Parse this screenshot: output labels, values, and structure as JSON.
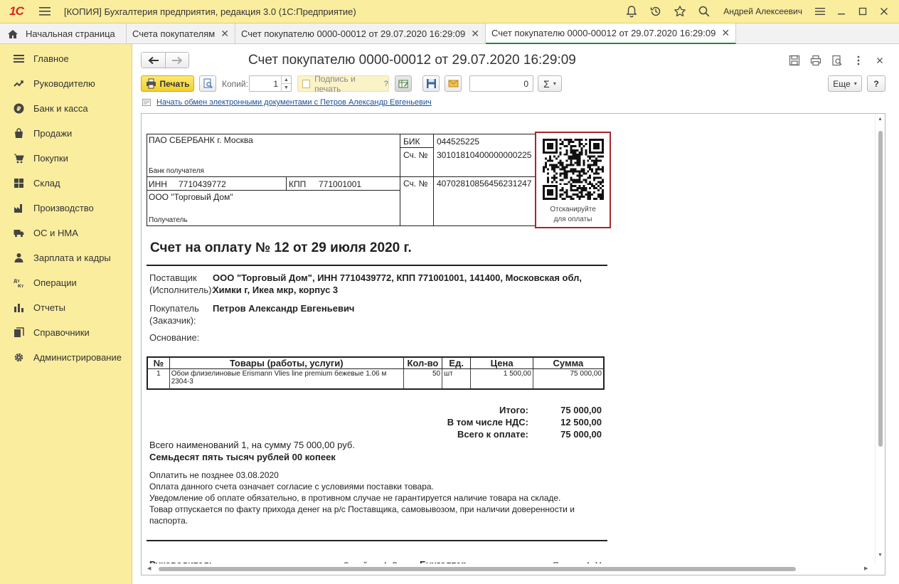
{
  "app": {
    "logo": "1С",
    "window_title": "[КОПИЯ] Бухгалтерия предприятия, редакция 3.0  (1С:Предприятие)",
    "user_name": "Андрей Алексеевич"
  },
  "tabs": [
    {
      "label": "Начальная страница"
    },
    {
      "label": "Счета покупателям"
    },
    {
      "label": "Счет покупателю 0000-00012 от 29.07.2020 16:29:09"
    },
    {
      "label": "Счет покупателю 0000-00012 от 29.07.2020 16:29:09"
    }
  ],
  "sidebar": {
    "items": [
      {
        "label": "Главное",
        "icon": "list-icon"
      },
      {
        "label": "Руководителю",
        "icon": "trend-icon"
      },
      {
        "label": "Банк и касса",
        "icon": "ruble-icon"
      },
      {
        "label": "Продажи",
        "icon": "bag-icon"
      },
      {
        "label": "Покупки",
        "icon": "cart-icon"
      },
      {
        "label": "Склад",
        "icon": "warehouse-icon"
      },
      {
        "label": "Производство",
        "icon": "factory-icon"
      },
      {
        "label": "ОС и НМА",
        "icon": "truck-icon"
      },
      {
        "label": "Зарплата и кадры",
        "icon": "person-icon"
      },
      {
        "label": "Операции",
        "icon": "dt-kt-icon"
      },
      {
        "label": "Отчеты",
        "icon": "bar-chart-icon"
      },
      {
        "label": "Справочники",
        "icon": "books-icon"
      },
      {
        "label": "Администрирование",
        "icon": "gear-icon"
      }
    ]
  },
  "document": {
    "title": "Счет покупателю 0000-00012 от 29.07.2020 16:29:09"
  },
  "toolbar": {
    "print_label": "Печать",
    "copies_label": "Копий:",
    "copies_value": "1",
    "sign_print_label": "Подпись и печать",
    "sign_help": "?",
    "sum_value": "0",
    "sigma": "Σ",
    "more_label": "Еще",
    "help_label": "?"
  },
  "edoc_link": "Начать обмен электронными документами с Петров Александр Евгеньевич",
  "invoice": {
    "bank_name": "ПАО СБЕРБАНК г. Москва",
    "bank_recipient_label": "Банк получателя",
    "bik_label": "БИК",
    "bik_value": "044525225",
    "acc_label": "Сч. №",
    "corr_account": "30101810400000000225",
    "inn_label": "ИНН",
    "inn_value": "7710439772",
    "kpp_label": "КПП",
    "kpp_value": "771001001",
    "recipient_name": "ООО \"Торговый Дом\"",
    "recipient_label": "Получатель",
    "account_label": "Сч. №",
    "account_value": "40702810856456231247",
    "qr_caption_1": "Отсканируйте",
    "qr_caption_2": "для оплаты",
    "title": "Счет на оплату № 12 от 29 июля 2020 г.",
    "supplier_label_1": "Поставщик",
    "supplier_label_2": "(Исполнитель):",
    "supplier_value": "ООО \"Торговый Дом\", ИНН 7710439772, КПП 771001001, 141400, Московская обл, Химки г, Икеа мкр, корпус 3",
    "buyer_label_1": "Покупатель",
    "buyer_label_2": "(Заказчик):",
    "buyer_value": "Петров Александр Евгеньевич",
    "basis_label": "Основание:",
    "table": {
      "headers": [
        "№",
        "Товары (работы, услуги)",
        "Кол-во",
        "Ед.",
        "Цена",
        "Сумма"
      ],
      "rows": [
        [
          "1",
          "Обои флизелиновые Erismann Vlies line premium бежевые 1.06 м 2304-3",
          "50",
          "шт",
          "1 500,00",
          "75 000,00"
        ]
      ]
    },
    "total_label": "Итого:",
    "total_value": "75 000,00",
    "vat_label": "В том числе НДС:",
    "vat_value": "12 500,00",
    "pay_label": "Всего к оплате:",
    "pay_value": "75 000,00",
    "summary": "Всего наименований 1, на сумму 75 000,00 руб.",
    "amount_words": "Семьдесят пять тысяч рублей 00 копеек",
    "notes": [
      "Оплатить не позднее 03.08.2020",
      "Оплата данного счета означает согласие с условиями поставки товара.",
      "Уведомление об оплате обязательно, в противном случае не гарантируется наличие товара на складе.",
      "Товар отпускается по факту прихода денег на р/с Поставщика, самовывозом, при наличии доверенности и паспорта."
    ],
    "director_label": "Руководитель",
    "director_name": "Самойлов А. В.",
    "accountant_label": "Бухгалтер",
    "accountant_name": "Петрова А. М."
  },
  "colors": {
    "accent_yellow": "#fbed9e",
    "active_tab_underline": "#1a8a3f",
    "qr_frame": "#a8262c",
    "link": "#1b4f9c"
  }
}
